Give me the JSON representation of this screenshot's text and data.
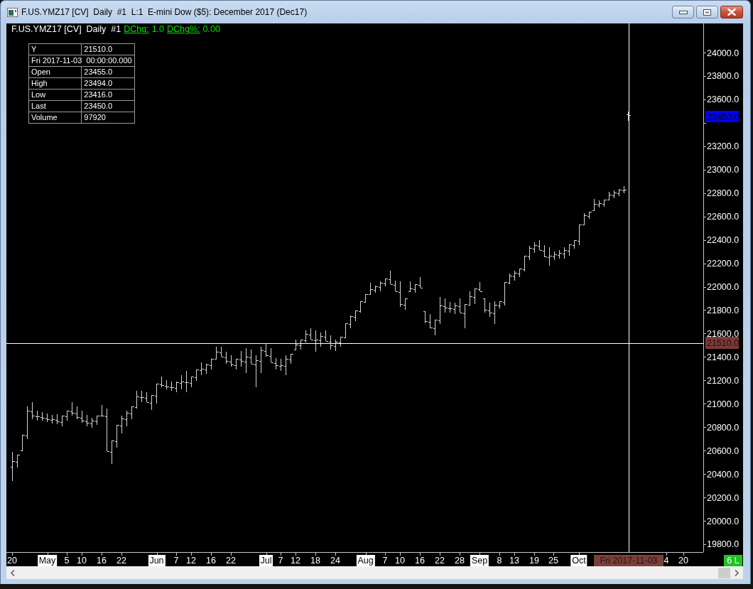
{
  "window": {
    "title": "F.US.YMZ17 [CV]  Daily  #1  L:1  E-mini Dow ($5): December 2017 (Dec17)"
  },
  "chart": {
    "header": {
      "title": "F.US.YMZ17 [CV]  Daily  #1",
      "studies": [
        {
          "label": "DChg:",
          "value": "1.0"
        },
        {
          "label": "DChg%:",
          "value": "0.00"
        }
      ]
    },
    "data_box": [
      {
        "kind": "pair",
        "label": "Y",
        "value": "21510.0"
      },
      {
        "kind": "span",
        "text": "Fri 2017-11-03  00:00:00.000"
      },
      {
        "kind": "pair",
        "label": "Open",
        "value": "23455.0"
      },
      {
        "kind": "pair",
        "label": "High",
        "value": "23494.0"
      },
      {
        "kind": "pair",
        "label": "Low",
        "value": "23416.0"
      },
      {
        "kind": "pair",
        "label": "Last",
        "value": "23450.0"
      },
      {
        "kind": "pair",
        "label": "Volume",
        "value": "97920"
      }
    ],
    "price_axis": {
      "labels": [
        "24000.0",
        "23800.0",
        "23600.0",
        "23200.0",
        "23000.0",
        "22800.0",
        "22600.0",
        "22400.0",
        "22200.0",
        "22000.0",
        "21800.0",
        "21600.0",
        "21400.0",
        "21200.0",
        "21000.0",
        "20800.0",
        "20600.0",
        "20400.0",
        "20200.0",
        "20000.0",
        "19800.0"
      ],
      "last_price": "23450.0",
      "cursor_price": "21510.0"
    },
    "time_axis": {
      "labels": [
        {
          "kind": "day",
          "text": "20"
        },
        {
          "kind": "month",
          "text": "May"
        },
        {
          "kind": "day",
          "text": "5"
        },
        {
          "kind": "day",
          "text": "10"
        },
        {
          "kind": "day",
          "text": "16"
        },
        {
          "kind": "day",
          "text": "22"
        },
        {
          "kind": "month",
          "text": "Jun"
        },
        {
          "kind": "day",
          "text": "7"
        },
        {
          "kind": "day",
          "text": "12"
        },
        {
          "kind": "day",
          "text": "16"
        },
        {
          "kind": "day",
          "text": "22"
        },
        {
          "kind": "month",
          "text": "Jul"
        },
        {
          "kind": "day",
          "text": "7"
        },
        {
          "kind": "day",
          "text": "12"
        },
        {
          "kind": "day",
          "text": "18"
        },
        {
          "kind": "day",
          "text": "24"
        },
        {
          "kind": "month",
          "text": "Aug"
        },
        {
          "kind": "day",
          "text": "7"
        },
        {
          "kind": "day",
          "text": "10"
        },
        {
          "kind": "day",
          "text": "16"
        },
        {
          "kind": "day",
          "text": "22"
        },
        {
          "kind": "day",
          "text": "28"
        },
        {
          "kind": "month",
          "text": "Sep"
        },
        {
          "kind": "day",
          "text": "8"
        },
        {
          "kind": "day",
          "text": "13"
        },
        {
          "kind": "day",
          "text": "19"
        },
        {
          "kind": "day",
          "text": "25"
        },
        {
          "kind": "month",
          "text": "Oct"
        },
        {
          "kind": "day",
          "text": "4"
        },
        {
          "kind": "day",
          "text": "20"
        }
      ],
      "cursor_date": "Fri 2017-11-03",
      "badge": "6 L"
    }
  }
}
